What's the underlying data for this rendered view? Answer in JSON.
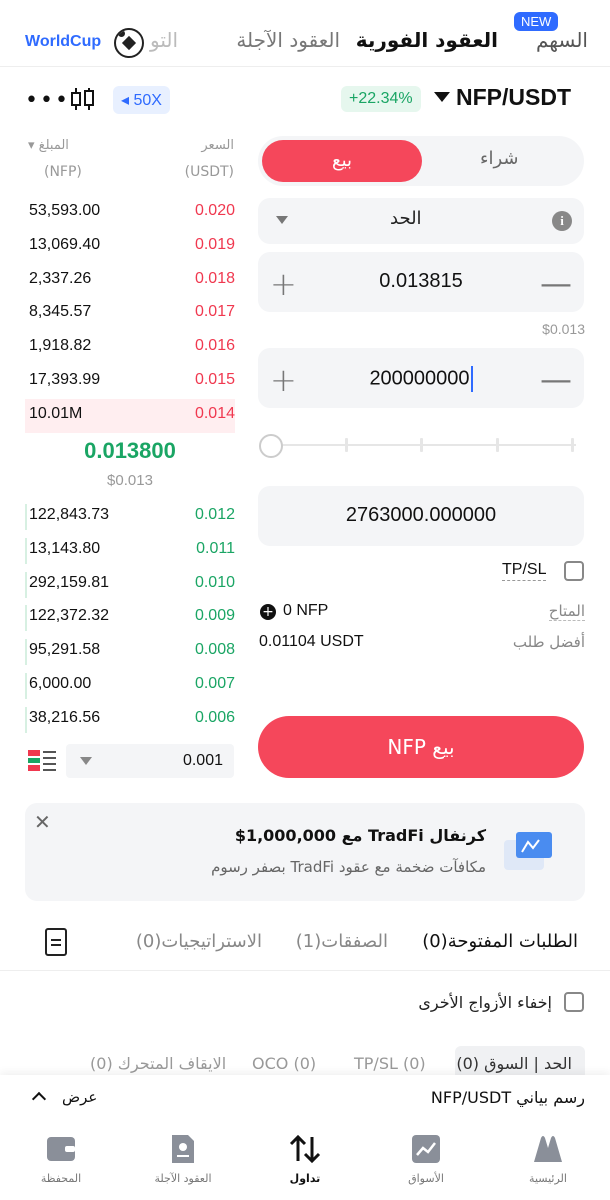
{
  "top_tabs": {
    "stocks": "السهم",
    "new_badge": "NEW",
    "spot": "العقود الفورية",
    "futures": "العقود الآجلة",
    "more": "التو",
    "worldcup": "WorldCup"
  },
  "pair_bar": {
    "more": "•••",
    "leverage": "50X",
    "change": "+22.34%",
    "pair": "NFP/USDT"
  },
  "order_book": {
    "col_price": "السعر",
    "col_price_unit": "(USDT)",
    "col_amount": "المبلغ",
    "col_amount_unit": "(NFP)",
    "asks": [
      {
        "amount": "53,593.00",
        "price": "0.020"
      },
      {
        "amount": "13,069.40",
        "price": "0.019"
      },
      {
        "amount": "2,337.26",
        "price": "0.018"
      },
      {
        "amount": "8,345.57",
        "price": "0.017"
      },
      {
        "amount": "1,918.82",
        "price": "0.016"
      },
      {
        "amount": "17,393.99",
        "price": "0.015"
      },
      {
        "amount": "10.01M",
        "price": "0.014"
      }
    ],
    "mid_price": "0.013800",
    "mid_usd": "$0.013",
    "bids": [
      {
        "amount": "122,843.73",
        "price": "0.012"
      },
      {
        "amount": "13,143.80",
        "price": "0.011"
      },
      {
        "amount": "292,159.81",
        "price": "0.010"
      },
      {
        "amount": "122,372.32",
        "price": "0.009"
      },
      {
        "amount": "95,291.58",
        "price": "0.008"
      },
      {
        "amount": "6,000.00",
        "price": "0.007"
      },
      {
        "amount": "38,216.56",
        "price": "0.006"
      }
    ],
    "depth_value": "0.001"
  },
  "trade_panel": {
    "buy": "شراء",
    "sell": "بيع",
    "order_type": "الحد",
    "price": "0.013815",
    "price_usd": "$0.013",
    "amount": "200000000",
    "total": "2763000.000000",
    "tpsl": "TP/SL",
    "available_label": "المتاح",
    "available_value": "0 NFP",
    "best_bid_label": "أفضل طلب",
    "best_bid_value": "0.01104 USDT",
    "sell_button": "بيع NFP"
  },
  "promo": {
    "title": "كرنفال TradFi مع 1,000,000$",
    "subtitle": "مكافآت ضخمة مع عقود TradFi بصفر رسوم"
  },
  "orders_tabs": {
    "open": "الطلبات المفتوحة(0)",
    "trades": "الصفقات(1)",
    "strategies": "الاستراتيجيات(0)",
    "hide_others": "إخفاء الأزواج الأخرى",
    "filters": {
      "limit_market": "الحد | السوق (0)",
      "tpsl": "TP/SL (0)",
      "oco": "OCO (0)",
      "trailing": "الايقاف المتحرك (0)"
    }
  },
  "chart_sheet": {
    "show": "عرض",
    "title": "رسم بياني NFP/USDT"
  },
  "bottom_nav": {
    "home": "الرئيسية",
    "markets": "الأسواق",
    "trade": "تداول",
    "futures": "العقود الآجلة",
    "wallet": "المحفظة"
  },
  "colors": {
    "sell": "#f5475b",
    "ask": "#f0384f",
    "bid": "#1aa564",
    "accent": "#2f6bff"
  }
}
